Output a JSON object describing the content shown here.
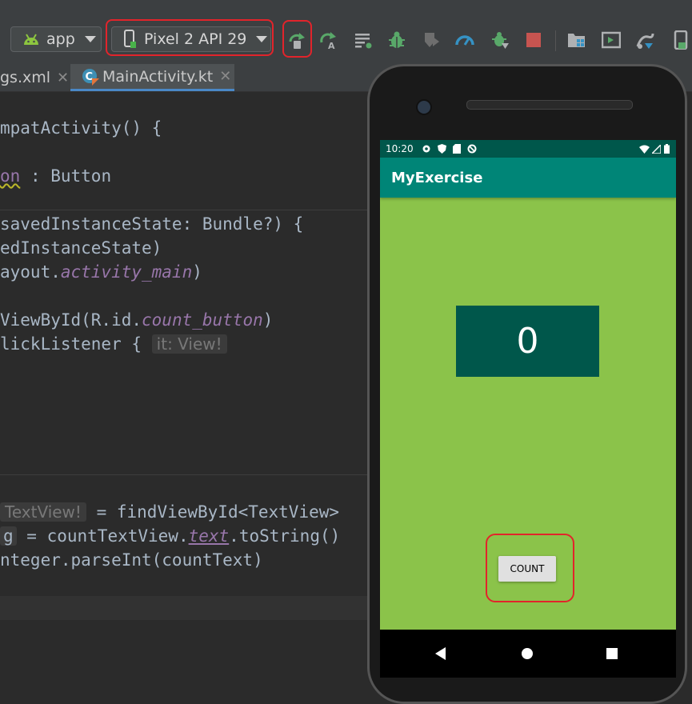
{
  "toolbar": {
    "run_config": "app",
    "device": "Pixel 2 API 29",
    "icons": [
      "run-apply-changes-icon",
      "apply-code-changes-icon",
      "logcat-icon",
      "debug-icon",
      "coverage-icon",
      "profile-icon",
      "attach-debugger-icon",
      "stop-icon",
      "project-structure-icon",
      "avd-manager-icon",
      "sdk-manager-icon"
    ],
    "highlight_color": "#e2242b"
  },
  "tabs": [
    {
      "label": "gs.xml"
    },
    {
      "label": "MainActivity.kt",
      "active": true
    }
  ],
  "editor": {
    "lines": [
      "mpatActivity() {",
      "on",
      " : Button",
      "savedInstanceState: Bundle?) {",
      "edInstanceState)",
      "ayout.",
      "activity_main",
      ")",
      "ViewById(R.id.",
      "count_button",
      ")",
      "lickListener {",
      "it: View!",
      "TextView!",
      " = findViewById<TextView>",
      "g",
      " = countTextView.",
      "text",
      ".toString()",
      "nteger.parseInt(countText)"
    ]
  },
  "emulator": {
    "status_time": "10:20",
    "app_title": "MyExercise",
    "count_value": "0",
    "count_button": "COUNT",
    "colors": {
      "primary": "#008577",
      "primary_dark": "#00574b",
      "background": "#8bc34a"
    }
  }
}
